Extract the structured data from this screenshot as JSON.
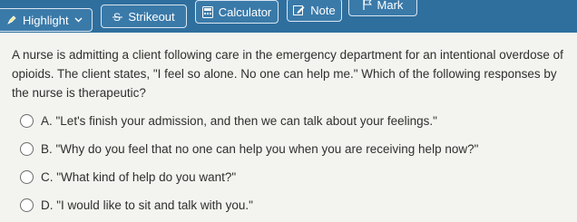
{
  "toolbar": {
    "highlight_label": "Highlight",
    "strikeout_label": "Strikeout",
    "calculator_label": "Calculator",
    "note_label": "Note",
    "mark_label": "Mark",
    "icons": [
      "highlighter-icon",
      "chevron-down-icon",
      "strikeout-icon",
      "calculator-icon",
      "note-icon",
      "flag-icon"
    ],
    "bg_color": "#2f6f9e"
  },
  "question": {
    "stem": "A nurse is admitting a client following care in the emergency department for an intentional overdose of opioids. The client states, \"I feel so alone. No one can help me.\" Which of the following responses by the nurse is therapeutic?"
  },
  "options": [
    {
      "text": "A. \"Let's finish your admission, and then we can talk about your feelings.\""
    },
    {
      "text": "B. \"Why do you feel that no one can help you when you are receiving help now?\""
    },
    {
      "text": "C. \"What kind of help do you want?\""
    },
    {
      "text": "D. \"I would like to sit and talk with you.\""
    }
  ]
}
